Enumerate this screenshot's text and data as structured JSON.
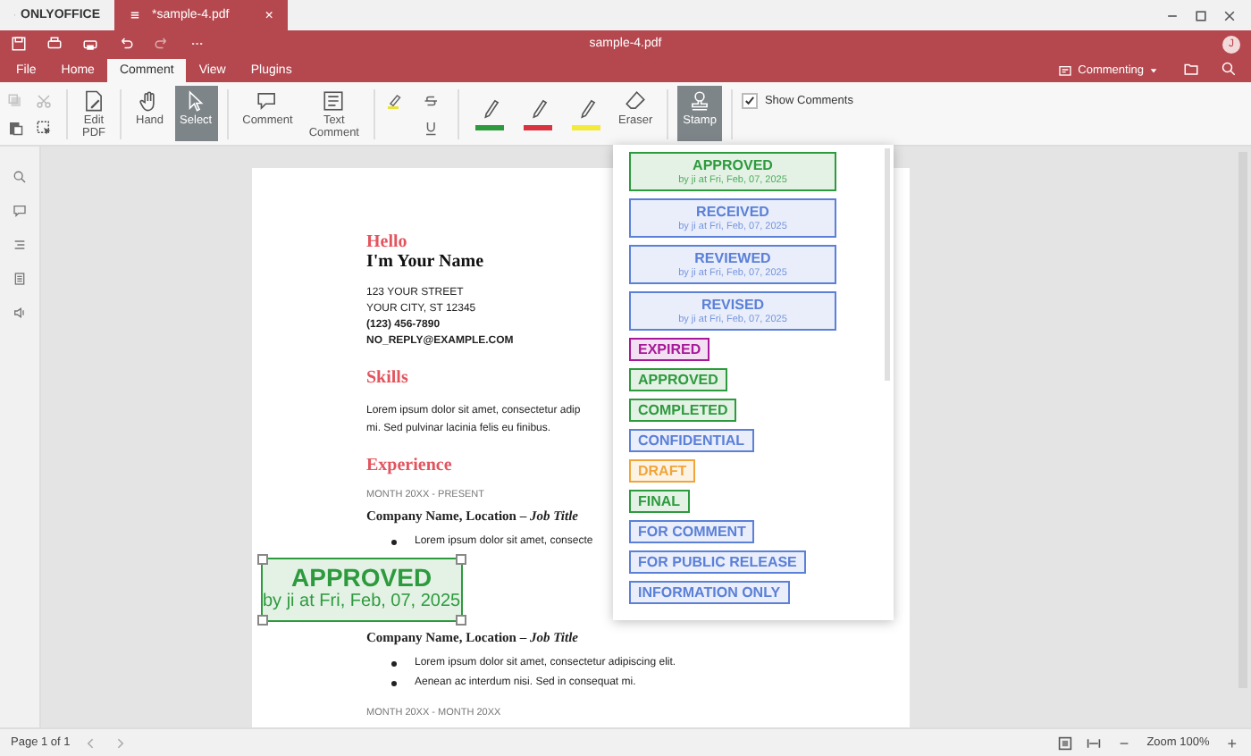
{
  "app_bar": {
    "logo": "ONLYOFFICE",
    "tab": {
      "title": "*sample-4.pdf",
      "close": "×"
    }
  },
  "header": {
    "title": "sample-4.pdf",
    "avatar": "J"
  },
  "menu_tabs": [
    {
      "label": "File",
      "selected": false
    },
    {
      "label": "Home",
      "selected": false
    },
    {
      "label": "Comment",
      "selected": true
    },
    {
      "label": "View",
      "selected": false
    },
    {
      "label": "Plugins",
      "selected": false
    }
  ],
  "mode": {
    "label": "Commenting"
  },
  "toolbar": {
    "edit_pdf": "Edit\nPDF",
    "hand": {
      "label": "Hand",
      "selected": false
    },
    "select": {
      "label": "Select",
      "selected": true
    },
    "comment": "Comment",
    "text_comment": "Text\nComment",
    "pens": [
      {
        "color": "#2e9a3e"
      },
      {
        "color": "#d9333f"
      },
      {
        "color": "#f3ea3c"
      }
    ],
    "eraser": "Eraser",
    "stamp": {
      "label": "Stamp",
      "selected": true
    },
    "show_comments": {
      "label": "Show Comments",
      "checked": true
    }
  },
  "stamp_menu": [
    {
      "label": "APPROVED",
      "subtitle": "by ji at Fri, Feb, 07, 2025",
      "color": "#2e9a3e"
    },
    {
      "label": "RECEIVED",
      "subtitle": "by ji at Fri, Feb, 07, 2025",
      "color": "#5b80d8"
    },
    {
      "label": "REVIEWED",
      "subtitle": "by ji at Fri, Feb, 07, 2025",
      "color": "#5b80d8"
    },
    {
      "label": "REVISED",
      "subtitle": "by ji at Fri, Feb, 07, 2025",
      "color": "#5b80d8"
    },
    {
      "label": "EXPIRED",
      "color": "#a8189a"
    },
    {
      "label": "APPROVED",
      "color": "#2e9a3e"
    },
    {
      "label": "COMPLETED",
      "color": "#2e9a3e"
    },
    {
      "label": "CONFIDENTIAL",
      "color": "#5b80d8"
    },
    {
      "label": "DRAFT",
      "color": "#f0a53a"
    },
    {
      "label": "FINAL",
      "color": "#2e9a3e"
    },
    {
      "label": "FOR COMMENT",
      "color": "#5b80d8"
    },
    {
      "label": "FOR PUBLIC RELEASE",
      "color": "#5b80d8"
    },
    {
      "label": "INFORMATION ONLY",
      "color": "#5b80d8"
    }
  ],
  "document": {
    "greeting": "Hello",
    "name": "I'm Your Name",
    "address": [
      "123 YOUR STREET",
      "YOUR CITY, ST 12345"
    ],
    "phone": "(123) 456-7890",
    "email": "NO_REPLY@EXAMPLE.COM",
    "skills_heading": "Skills",
    "skills_text": [
      "Lorem ipsum dolor sit amet, consectetur adip",
      "mi. Sed pulvinar lacinia felis eu finibus."
    ],
    "experience_heading": "Experience",
    "jobs_top": {
      "dates": "MONTH 20XX - PRESENT",
      "title": "Company Name, Location – *Job Title*",
      "bullets": [
        "Lorem ipsum dolor sit amet, consecte"
      ]
    },
    "placed_stamp": {
      "label": "APPROVED",
      "subtitle": "by ji at Fri, Feb, 07, 2025",
      "color": "#2e9a3e"
    },
    "jobs_bottom": {
      "title": "Company Name, Location – *Job Title*",
      "bullets": [
        "Lorem ipsum dolor sit amet, consectetur adipiscing elit.",
        "Aenean ac interdum nisi. Sed in consequat mi."
      ],
      "dates": "MONTH 20XX - MONTH 20XX"
    }
  },
  "status_bar": {
    "page": "Page 1 of 1",
    "zoom": "Zoom 100%",
    "zoom_out": "−",
    "zoom_in": "+"
  }
}
